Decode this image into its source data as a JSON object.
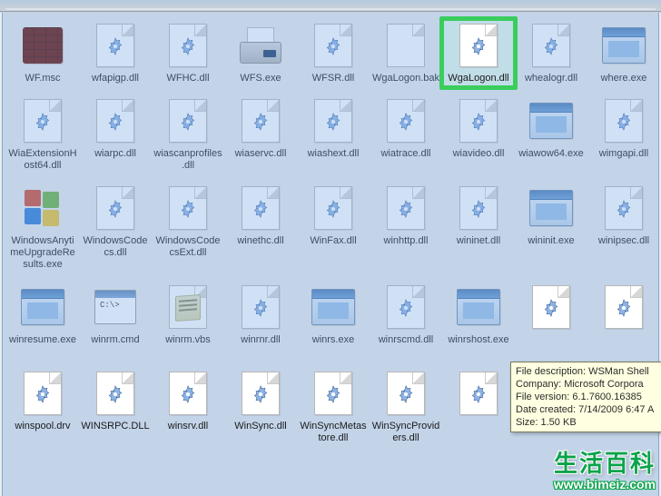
{
  "tooltip": {
    "line1": "File description: WSMan Shell",
    "line2": "Company: Microsoft Corpora",
    "line3": "File version: 6.1.7600.16385",
    "line4": "Date created: 7/14/2009 6:47 A",
    "line5": "Size: 1.50 KB"
  },
  "watermark": {
    "text": "生活百科",
    "url": "www.bimeiz.com"
  },
  "files": {
    "r1": [
      {
        "name": "WF.msc",
        "icon": "firewall"
      },
      {
        "name": "wfapigp.dll",
        "icon": "sys-dll"
      },
      {
        "name": "WFHC.dll",
        "icon": "sys-dll"
      },
      {
        "name": "WFS.exe",
        "icon": "fax"
      },
      {
        "name": "WFSR.dll",
        "icon": "sys-dll"
      },
      {
        "name": "WgaLogon.bak",
        "icon": "page-blank"
      },
      {
        "name": "WgaLogon.dll",
        "icon": "sys-dll",
        "highlight": true
      },
      {
        "name": "whealogr.dll",
        "icon": "sys-dll"
      },
      {
        "name": "where.exe",
        "icon": "exe-win"
      }
    ],
    "r2": [
      {
        "name": "WiaExtensionHost64.dll",
        "icon": "sys-dll"
      },
      {
        "name": "wiarpc.dll",
        "icon": "sys-dll"
      },
      {
        "name": "wiascanprofiles.dll",
        "icon": "sys-dll"
      },
      {
        "name": "wiaservc.dll",
        "icon": "sys-dll"
      },
      {
        "name": "wiashext.dll",
        "icon": "sys-dll"
      },
      {
        "name": "wiatrace.dll",
        "icon": "sys-dll"
      },
      {
        "name": "wiavideo.dll",
        "icon": "sys-dll"
      },
      {
        "name": "wiawow64.exe",
        "icon": "exe-win"
      },
      {
        "name": "wimgapi.dll",
        "icon": "sys-dll"
      }
    ],
    "r3": [
      {
        "name": "WindowsAnytimeUpgradeResults.exe",
        "icon": "winflag"
      },
      {
        "name": "WindowsCodecs.dll",
        "icon": "sys-dll"
      },
      {
        "name": "WindowsCodecsExt.dll",
        "icon": "sys-dll"
      },
      {
        "name": "winethc.dll",
        "icon": "sys-dll"
      },
      {
        "name": "WinFax.dll",
        "icon": "sys-dll"
      },
      {
        "name": "winhttp.dll",
        "icon": "sys-dll"
      },
      {
        "name": "wininet.dll",
        "icon": "sys-dll"
      },
      {
        "name": "wininit.exe",
        "icon": "exe-win"
      },
      {
        "name": "winipsec.dll",
        "icon": "sys-dll"
      }
    ],
    "r4": [
      {
        "name": "winresume.exe",
        "icon": "exe-win"
      },
      {
        "name": "winrm.cmd",
        "icon": "cmd"
      },
      {
        "name": "winrm.vbs",
        "icon": "vbs"
      },
      {
        "name": "winrnr.dll",
        "icon": "sys-dll"
      },
      {
        "name": "winrs.exe",
        "icon": "exe-win"
      },
      {
        "name": "winrscmd.dll",
        "icon": "sys-dll"
      },
      {
        "name": "winrshost.exe",
        "icon": "exe-win"
      },
      {
        "name": "",
        "icon": "sys-dll",
        "sel": true
      },
      {
        "name": "",
        "icon": "sys-dll"
      }
    ],
    "r5": [
      {
        "name": "winspool.drv",
        "icon": "sys-dll"
      },
      {
        "name": "WINSRPC.DLL",
        "icon": "sys-dll"
      },
      {
        "name": "winsrv.dll",
        "icon": "sys-dll"
      },
      {
        "name": "WinSync.dll",
        "icon": "sys-dll"
      },
      {
        "name": "WinSyncMetastore.dll",
        "icon": "sys-dll"
      },
      {
        "name": "WinSyncProviders.dll",
        "icon": "sys-dll"
      },
      {
        "name": "",
        "icon": "sys-dll"
      },
      {
        "name": "",
        "icon": "sys-dll"
      },
      {
        "name": "",
        "icon": "sys-dll"
      }
    ]
  }
}
